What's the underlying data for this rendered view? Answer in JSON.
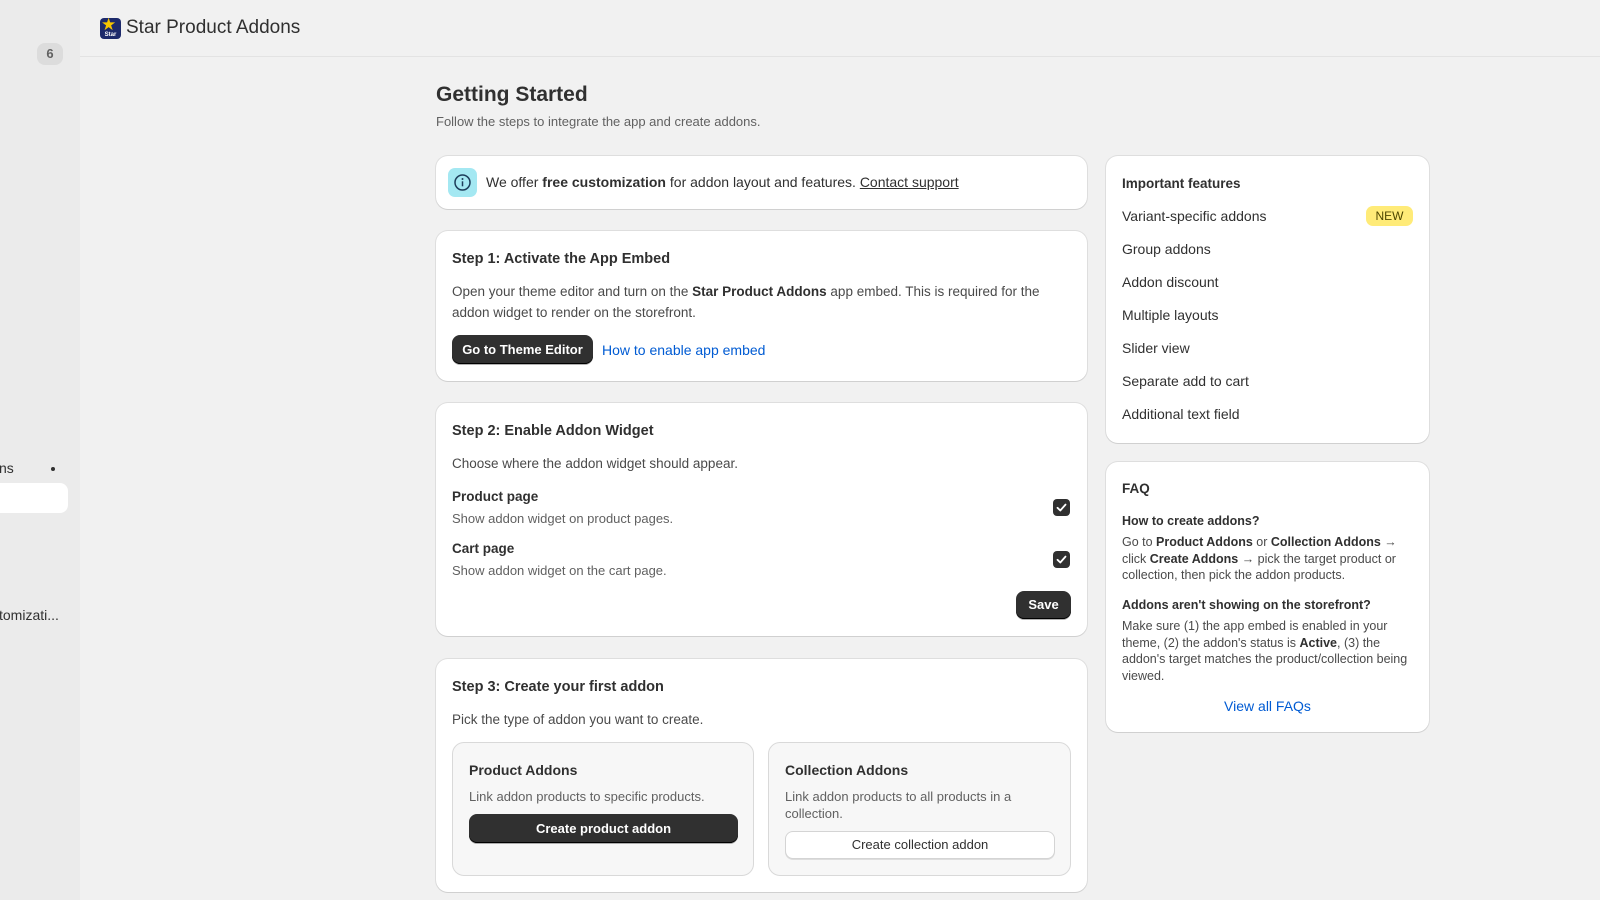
{
  "sidebar": {
    "badge_count": "6",
    "item_apps": "ns",
    "item_customization": "tomizati..."
  },
  "app": {
    "title": "Star Product Addons",
    "logo_text": "Star"
  },
  "page": {
    "title": "Getting Started",
    "subtitle": "Follow the steps to integrate the app and create addons."
  },
  "banner": {
    "prefix": "We offer ",
    "bold": "free customization",
    "suffix": " for addon layout and features. ",
    "link": "Contact support"
  },
  "step1": {
    "title": "Step 1: Activate the App Embed",
    "text_prefix": "Open your theme editor and turn on the ",
    "text_bold": "Star Product Addons",
    "text_suffix": " app embed. This is required for the addon widget to render on the storefront.",
    "button": "Go to Theme Editor",
    "link": "How to enable app embed"
  },
  "step2": {
    "title": "Step 2: Enable Addon Widget",
    "text": "Choose where the addon widget should appear.",
    "options": [
      {
        "label": "Product page",
        "description": "Show addon widget on product pages.",
        "checked": true
      },
      {
        "label": "Cart page",
        "description": "Show addon widget on the cart page.",
        "checked": true
      }
    ],
    "save": "Save"
  },
  "step3": {
    "title": "Step 3: Create your first addon",
    "text": "Pick the type of addon you want to create.",
    "product": {
      "title": "Product Addons",
      "text": "Link addon products to specific products.",
      "button": "Create product addon"
    },
    "collection": {
      "title": "Collection Addons",
      "text": "Link addon products to all products in a collection.",
      "button": "Create collection addon"
    }
  },
  "features": {
    "title": "Important features",
    "new_badge": "NEW",
    "items": [
      "Variant-specific addons",
      "Group addons",
      "Addon discount",
      "Multiple layouts",
      "Slider view",
      "Separate add to cart",
      "Additional text field"
    ]
  },
  "faq": {
    "title": "FAQ",
    "q1": "How to create addons?",
    "a1": [
      "Go to ",
      "Product Addons",
      " or ",
      "Collection Addons",
      " → click ",
      "Create Addons",
      " → pick the target product or collection, then pick the addon products."
    ],
    "q2": "Addons aren't showing on the storefront?",
    "a2": [
      "Make sure (1) the app embed is enabled in your theme, (2) the addon's status is ",
      "Active",
      ", (3) the addon's target matches the product/collection being viewed."
    ],
    "link": "View all FAQs"
  },
  "colors": {
    "primary_button": "#303030",
    "link": "#005bd3",
    "info_icon_bg": "#a4e8f2",
    "new_badge_bg": "#ffeb78"
  }
}
